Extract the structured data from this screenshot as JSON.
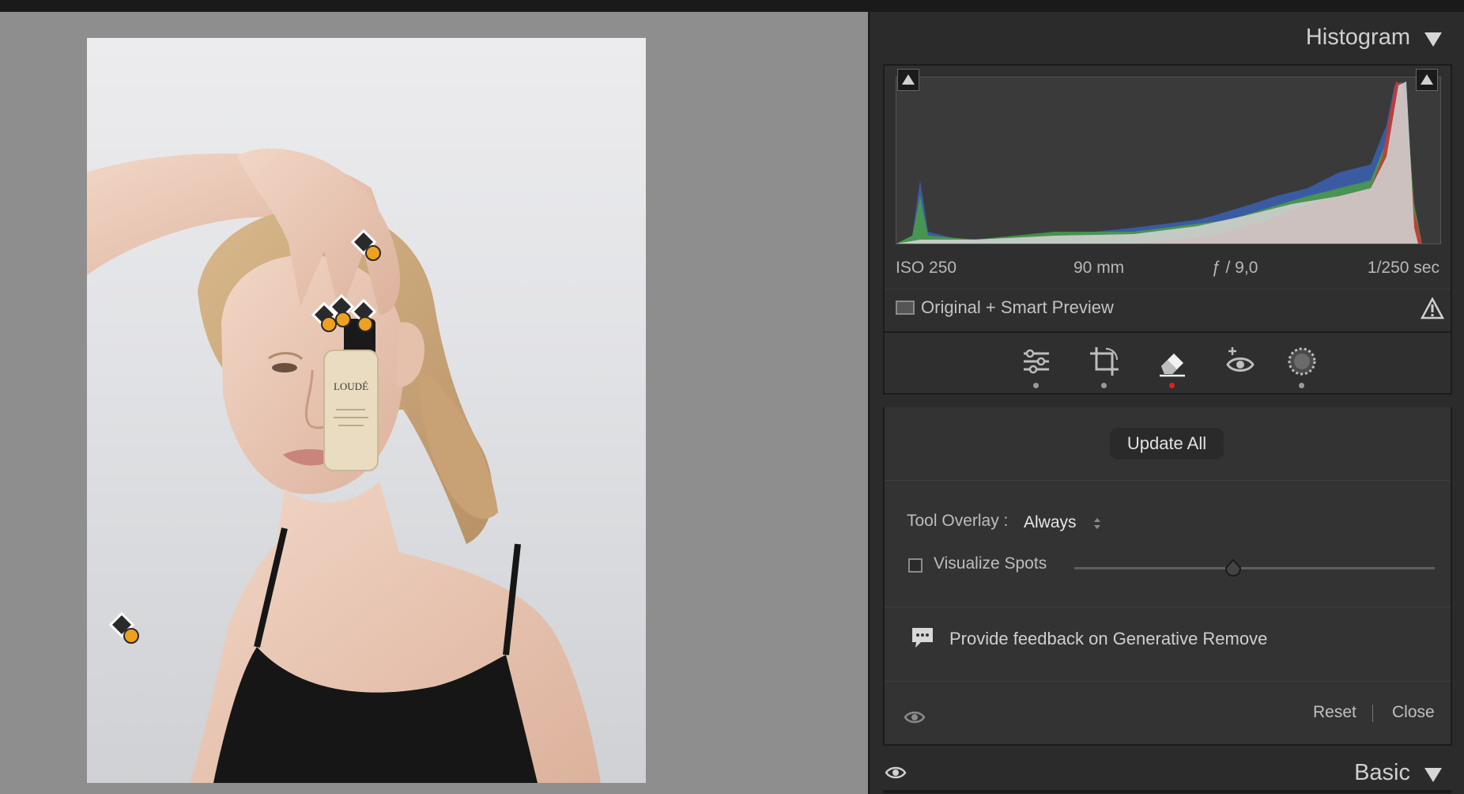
{
  "panel": {
    "histogram_title": "Histogram",
    "exif": {
      "iso": "ISO 250",
      "focal": "90 mm",
      "aperture": "ƒ / 9,0",
      "shutter": "1/250 sec"
    },
    "preview_status": "Original + Smart Preview",
    "tools": [
      {
        "name": "edit-sliders-icon",
        "active": false
      },
      {
        "name": "crop-icon",
        "active": false
      },
      {
        "name": "remove-eraser-icon",
        "active": true
      },
      {
        "name": "red-eye-icon",
        "active": false
      },
      {
        "name": "masking-icon",
        "active": false
      }
    ],
    "update_all_label": "Update All",
    "tool_overlay_label": "Tool Overlay :",
    "tool_overlay_value": "Always",
    "visualize_spots_label": "Visualize Spots",
    "visualize_spots_checked": false,
    "visualize_spots_level": 0.4,
    "feedback_label": "Provide feedback on Generative Remove",
    "reset_label": "Reset",
    "close_label": "Close",
    "basic_title": "Basic"
  },
  "photo": {
    "bottle_label": "LOUDÉ"
  },
  "colors": {
    "panel_bg": "#2b2b2b",
    "canvas_bg": "#8e8e8e",
    "active_dot": "#e02020",
    "pin_badge": "#f0a020"
  }
}
